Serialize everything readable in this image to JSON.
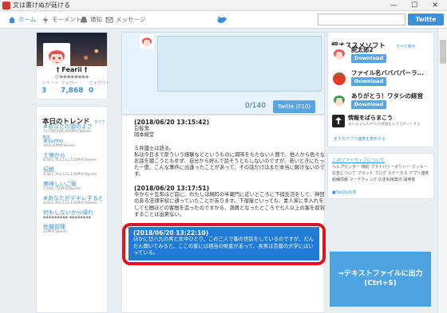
{
  "window": {
    "title": "文は書けぬが廷ける",
    "minimize": "—",
    "maximize": "☐",
    "close": "✕"
  },
  "nav": {
    "home": "ホーム",
    "moments": "モーメント",
    "notifications": "通知",
    "messages": "メッセージ",
    "search_placeholder": "",
    "twitter_button": "Twitte"
  },
  "profile": {
    "name": "† Fearii †",
    "handle": "@◆◆◆◆◆◆◆◆",
    "tweets_label": "ツイート",
    "tweets": "3",
    "following_label": "フォロー",
    "following": "7,868",
    "followers_label": "フォロワー",
    "followers": "0"
  },
  "trends": {
    "title": "本日のトレンド",
    "more": "すべて表示",
    "items": [
      {
        "tag": "#あなたの頭のよさ",
        "sub": "71,789,186,916件のTweets"
      },
      {
        "tag": "#sumo",
        "sub": "10,530件のTweets"
      },
      {
        "tag": "土俵から",
        "sub": "8,463,763,153,156件のTweets"
      },
      {
        "tag": "伝統",
        "sub": "8,463,763,153,156件のTweets"
      },
      {
        "tag": "美味しいご飯",
        "sub": "7,508,725件のTweets"
      },
      {
        "tag": "#あなたがデキレすると",
        "sub": "8,463,763,153,156件のTweets"
      },
      {
        "tag": "何もしないから帰れ",
        "sub": "◆◆◆◆◆◆◆◆◆ ◆◆◆◆◆◆◆◆"
      },
      {
        "tag": "危機管理",
        "sub": "32件のTweets"
      }
    ]
  },
  "compose": {
    "count": "0/140",
    "button": "Twitte (F10)"
  },
  "tweets": [
    {
      "time": "(2018/06/20 13:15:42)",
      "lines": [
        "白髪鬼",
        "岡本綺堂",
        "",
        "Ｓ弁護士は語る。",
        "私は今日まで斯ういう経験などというものに興味をもたない人間で、他人から色々なお話を聴こうともせず、自分から好んで話そうともしないのですが、若いときにたった一度、こんな事件に出逢ったことがあって、その話だけはまだ本当に解けないのです。"
      ]
    },
    {
      "time": "(2018/06/20 13:17:51)",
      "lines": [
        "今から十五年ほど前に、わたしは麹町の半蔵門に近いところに下宿生活をして、神田のある法律学校に通っていたことがあります。下宿屋といっても、素人家に手入れをして七間ほどの客間を造ったのですから、満員となったところで七人以上の客を収容することは出来ない。"
      ]
    },
    {
      "time": "(2018/06/20 13:22:10)",
      "lines": [
        "ほかに廿八九の男と女中ひとり、この三人で客の世話をしているのですが、だんだん聞いてみると、ここの家には相当の財産があって、長男は京都の大学にはいっている。"
      ]
    }
  ],
  "apps": {
    "title": "超オススメソフト",
    "more": "すべて表示",
    "items": [
      {
        "name": "詫太郎2",
        "button": "Download"
      },
      {
        "name": "ファイル名バババパーラ...",
        "button": "Download"
      },
      {
        "name": "ありがとう！ワタシの経営",
        "button": "Download"
      }
    ],
    "info_title": "情報をばらまこう",
    "info_sub": "気になるものやTLの情報をエクスポートする",
    "info_link": "全てのアプリ連携を表示する"
  },
  "footer": {
    "about": "このソフトウェアについて",
    "links": "ヘルプセンター 規約 プライバシーポリシー クッキー 広告について ブランド ブログ ステータス アプリ連携 組織情報 マーケティング 広告利用案内 開発者",
    "copy": "■TwiZipの見"
  },
  "export_button": {
    "line1": "→テキストファイルに出力",
    "line2": "(Ctrl+S)"
  },
  "colors": {
    "accent": "#3a8fd8",
    "selection": "#1f7bd6",
    "highlight": "#e0141e",
    "export": "#4ea3e3"
  }
}
